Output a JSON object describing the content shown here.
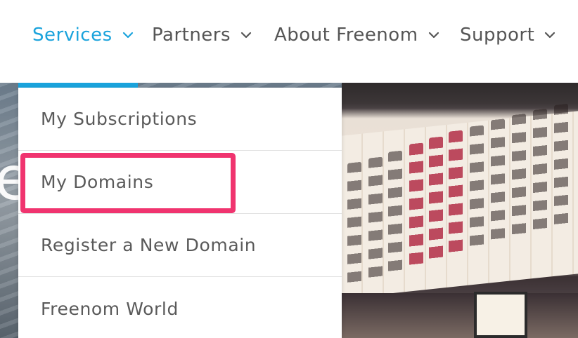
{
  "nav": {
    "items": [
      {
        "label": "Services",
        "active": true
      },
      {
        "label": "Partners",
        "active": false
      },
      {
        "label": "About Freenom",
        "active": false
      },
      {
        "label": "Support",
        "active": false
      }
    ]
  },
  "dropdown": {
    "items": [
      {
        "label": "My Subscriptions"
      },
      {
        "label": "My Domains",
        "highlighted": true
      },
      {
        "label": "Register a New Domain"
      },
      {
        "label": "Freenom World"
      }
    ]
  },
  "hero": {
    "partial_letter": "e"
  },
  "colors": {
    "accent": "#1aa3dc",
    "highlight": "#f0346f",
    "nav_text": "#555555",
    "menu_text": "#5a5a5a"
  },
  "icons": {
    "nav_chevron": "chevron-down-icon"
  }
}
